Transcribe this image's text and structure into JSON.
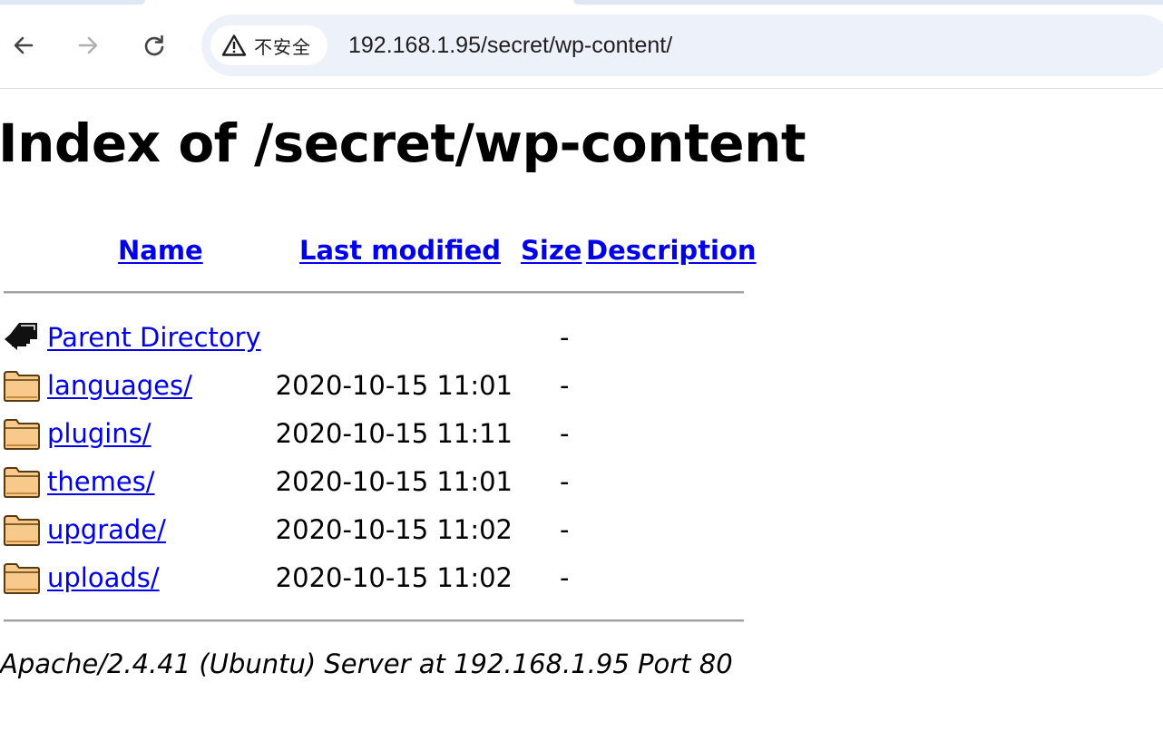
{
  "browser": {
    "security_label": "不安全",
    "url": "192.168.1.95/secret/wp-content/"
  },
  "page": {
    "title": "Index of /secret/wp-content",
    "columns": {
      "name": "Name",
      "last_modified": "Last modified",
      "size": "Size",
      "description": "Description"
    },
    "parent": {
      "name": "Parent Directory",
      "size": "-",
      "icon": "back-arrow-icon"
    },
    "entries": [
      {
        "name": "languages/",
        "last_modified": "2020-10-15 11:01",
        "size": "-",
        "icon": "folder-icon"
      },
      {
        "name": "plugins/",
        "last_modified": "2020-10-15 11:11",
        "size": "-",
        "icon": "folder-icon"
      },
      {
        "name": "themes/",
        "last_modified": "2020-10-15 11:01",
        "size": "-",
        "icon": "folder-icon"
      },
      {
        "name": "upgrade/",
        "last_modified": "2020-10-15 11:02",
        "size": "-",
        "icon": "folder-icon"
      },
      {
        "name": "uploads/",
        "last_modified": "2020-10-15 11:02",
        "size": "-",
        "icon": "folder-icon"
      }
    ],
    "footer": "Apache/2.4.41 (Ubuntu) Server at 192.168.1.95 Port 80"
  },
  "colors": {
    "link": "#0000ee",
    "omnibox": "#edf2fa",
    "folder_fill": "#f7c98a"
  }
}
